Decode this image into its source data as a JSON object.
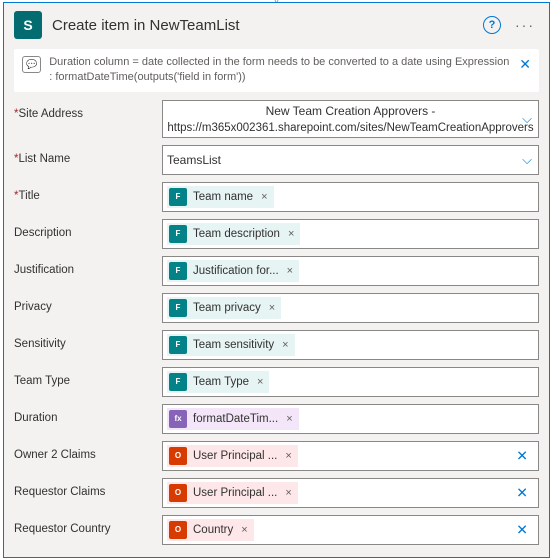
{
  "header": {
    "logo_letter": "S",
    "title": "Create item in NewTeamList"
  },
  "note": {
    "text": "Duration column = date collected in the form needs to be converted to a date using Expression : formatDateTime(outputs('field in form'))"
  },
  "labels": {
    "site": "Site Address",
    "list": "List Name",
    "title": "Title",
    "description": "Description",
    "justification": "Justification",
    "privacy": "Privacy",
    "sensitivity": "Sensitivity",
    "teamtype": "Team Type",
    "duration": "Duration",
    "owner2": "Owner 2 Claims",
    "reqclaims": "Requestor Claims",
    "reqcountry": "Requestor Country"
  },
  "values": {
    "site_name": "New Team Creation Approvers -",
    "site_url": "https://m365x002361.sharepoint.com/sites/NewTeamCreationApprovers",
    "list_name": "TeamsList"
  },
  "tokens": {
    "title": "Team name",
    "description": "Team description",
    "justification": "Justification for...",
    "privacy": "Team privacy",
    "sensitivity": "Team sensitivity",
    "teamtype": "Team Type",
    "duration": "formatDateTim...",
    "owner2": "User Principal ...",
    "reqclaims": "User Principal ...",
    "reqcountry": "Country",
    "fx": "fx",
    "forms_icon": "F",
    "office_icon": "O"
  }
}
